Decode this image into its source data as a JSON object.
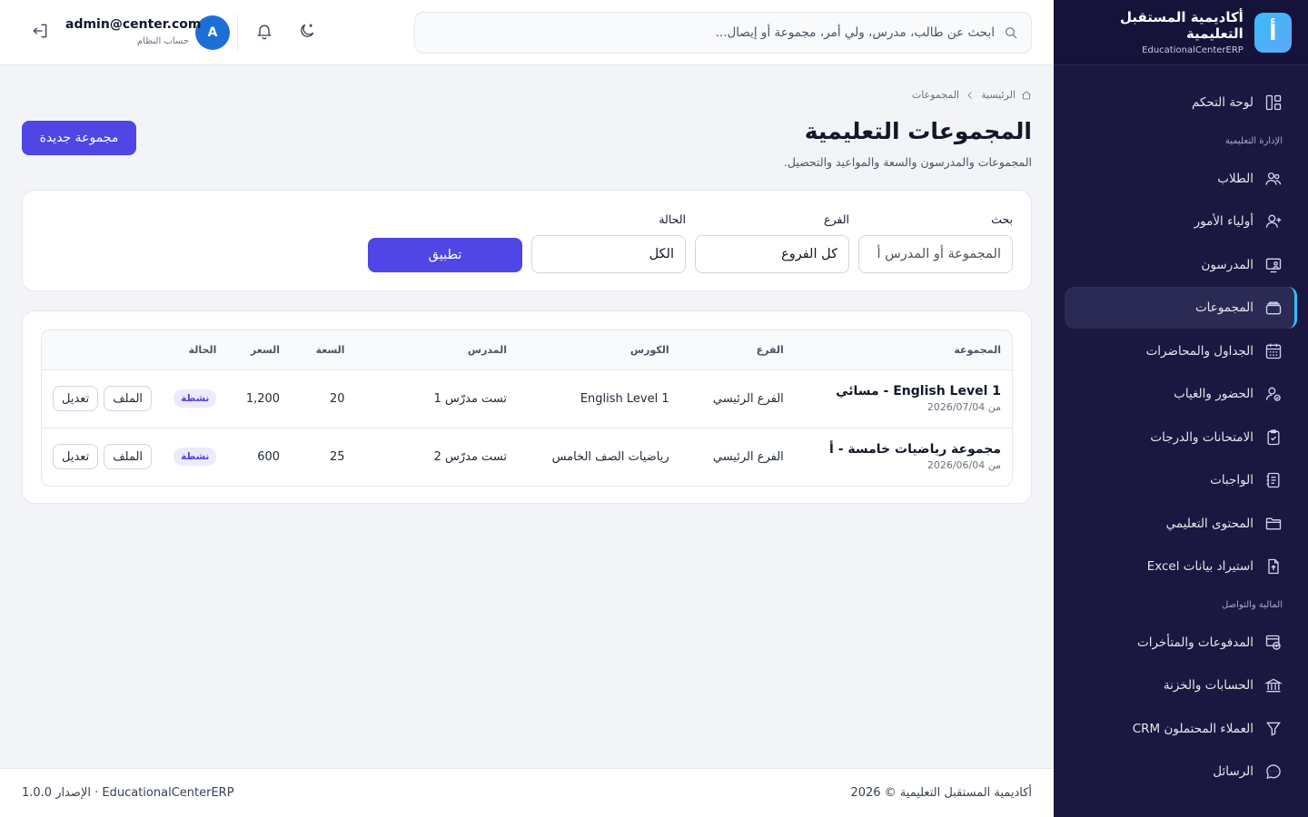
{
  "brand": {
    "logo_letter": "أ",
    "name": "أكاديمية المستقبل التعليمية",
    "subtitle": "EducationalCenterERP"
  },
  "sidebar": {
    "items": [
      {
        "label": "لوحة التحكم",
        "icon": "dashboard-icon"
      },
      {
        "section": "الإدارة التعليمية"
      },
      {
        "label": "الطلاب",
        "icon": "users-icon"
      },
      {
        "label": "أولياء الأمور",
        "icon": "user-plus-icon"
      },
      {
        "label": "المدرسون",
        "icon": "teacher-icon"
      },
      {
        "label": "المجموعات",
        "icon": "layers-icon",
        "active": true
      },
      {
        "label": "الجداول والمحاضرات",
        "icon": "calendar-icon"
      },
      {
        "label": "الحضور والغياب",
        "icon": "user-check-icon"
      },
      {
        "label": "الامتحانات والدرجات",
        "icon": "clipboard-icon"
      },
      {
        "label": "الواجبات",
        "icon": "notes-icon"
      },
      {
        "label": "المحتوى التعليمي",
        "icon": "folder-icon"
      },
      {
        "label": "استيراد بيانات Excel",
        "icon": "file-upload-icon"
      },
      {
        "section": "المالية والتواصل"
      },
      {
        "label": "المدفوعات والمتأخرات",
        "icon": "payments-icon"
      },
      {
        "label": "الحسابات والخزنة",
        "icon": "bank-icon"
      },
      {
        "label": "العملاء المحتملون CRM",
        "icon": "filter-icon"
      },
      {
        "label": "الرسائل",
        "icon": "message-icon"
      }
    ]
  },
  "topbar": {
    "search_placeholder": "ابحث عن طالب، مدرس، ولي أمر، مجموعة أو إيصال...",
    "user_initial": "A",
    "user_email": "admin@center.com",
    "user_role": "حساب النظام"
  },
  "breadcrumb": {
    "home": "الرئيسية",
    "current": "المجموعات"
  },
  "page": {
    "title": "المجموعات التعليمية",
    "subtitle": "المجموعات والمدرسون والسعة والمواعيد والتحصيل.",
    "new_button": "مجموعة جديدة"
  },
  "filters": {
    "search_label": "بحث",
    "search_placeholder": "المجموعة أو المدرس أ",
    "branch_label": "الفرع",
    "branch_value": "كل الفروع",
    "status_label": "الحالة",
    "status_value": "الكل",
    "apply": "تطبيق"
  },
  "table": {
    "headers": [
      "المجموعة",
      "الفرع",
      "الكورس",
      "المدرس",
      "السعة",
      "السعر",
      "الحالة"
    ],
    "rows": [
      {
        "name": "English Level 1 - مسائي",
        "date": "من 2026/07/04",
        "branch": "الفرع الرئيسي",
        "course": "English Level 1",
        "teacher": "تست مدرّس 1",
        "capacity": "20",
        "price": "1,200",
        "status": "نشطة",
        "file_btn": "الملف",
        "edit_btn": "تعديل"
      },
      {
        "name": "مجموعة رياضيات خامسة - أ",
        "date": "من 2026/06/04",
        "branch": "الفرع الرئيسي",
        "course": "رياضيات الصف الخامس",
        "teacher": "تست مدرّس 2",
        "capacity": "25",
        "price": "600",
        "status": "نشطة",
        "file_btn": "الملف",
        "edit_btn": "تعديل"
      }
    ]
  },
  "footer": {
    "copyright": "أكاديمية المستقبل التعليمية © 2026",
    "version": "EducationalCenterERP · الإصدار 1.0.0"
  },
  "colors": {
    "primary": "#4f46e5",
    "sidebar_bg": "#1a1740",
    "active_border": "#38bdf8",
    "avatar": "#1d6fd8"
  }
}
